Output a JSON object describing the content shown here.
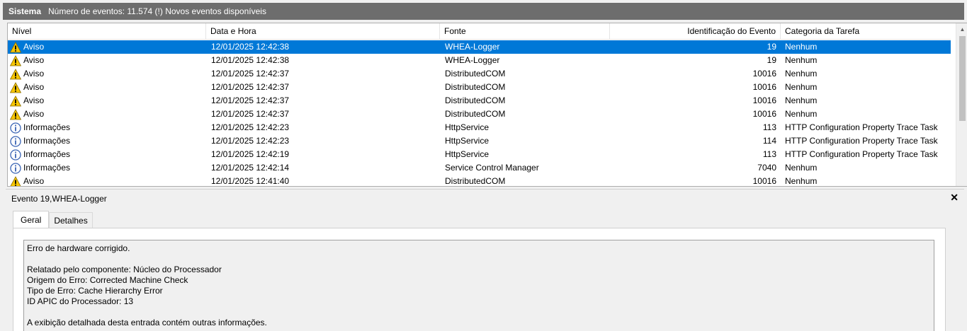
{
  "titlebar": {
    "log_name": "Sistema",
    "event_count": "Número de eventos: 11.574 (!) Novos eventos disponíveis"
  },
  "table": {
    "columns": [
      "Nível",
      "Data e Hora",
      "Fonte",
      "Identificação do Evento",
      "Categoria da Tarefa"
    ],
    "rows": [
      {
        "level": "Aviso",
        "icon": "warning-icon",
        "date": "12/01/2025 12:42:38",
        "source": "WHEA-Logger",
        "id": "19",
        "category": "Nenhum",
        "selected": true
      },
      {
        "level": "Aviso",
        "icon": "warning-icon",
        "date": "12/01/2025 12:42:38",
        "source": "WHEA-Logger",
        "id": "19",
        "category": "Nenhum"
      },
      {
        "level": "Aviso",
        "icon": "warning-icon",
        "date": "12/01/2025 12:42:37",
        "source": "DistributedCOM",
        "id": "10016",
        "category": "Nenhum"
      },
      {
        "level": "Aviso",
        "icon": "warning-icon",
        "date": "12/01/2025 12:42:37",
        "source": "DistributedCOM",
        "id": "10016",
        "category": "Nenhum"
      },
      {
        "level": "Aviso",
        "icon": "warning-icon",
        "date": "12/01/2025 12:42:37",
        "source": "DistributedCOM",
        "id": "10016",
        "category": "Nenhum"
      },
      {
        "level": "Aviso",
        "icon": "warning-icon",
        "date": "12/01/2025 12:42:37",
        "source": "DistributedCOM",
        "id": "10016",
        "category": "Nenhum"
      },
      {
        "level": "Informações",
        "icon": "info-icon",
        "date": "12/01/2025 12:42:23",
        "source": "HttpService",
        "id": "113",
        "category": "HTTP Configuration Property Trace Task"
      },
      {
        "level": "Informações",
        "icon": "info-icon",
        "date": "12/01/2025 12:42:23",
        "source": "HttpService",
        "id": "114",
        "category": "HTTP Configuration Property Trace Task"
      },
      {
        "level": "Informações",
        "icon": "info-icon",
        "date": "12/01/2025 12:42:19",
        "source": "HttpService",
        "id": "113",
        "category": "HTTP Configuration Property Trace Task"
      },
      {
        "level": "Informações",
        "icon": "info-icon",
        "date": "12/01/2025 12:42:14",
        "source": "Service Control Manager",
        "id": "7040",
        "category": "Nenhum"
      },
      {
        "level": "Aviso",
        "icon": "warning-icon",
        "date": "12/01/2025 12:41:40",
        "source": "DistributedCOM",
        "id": "10016",
        "category": "Nenhum"
      }
    ]
  },
  "detail": {
    "title": "Evento 19,WHEA-Logger",
    "close_icon": "close-icon",
    "tabs": [
      "Geral",
      "Detalhes"
    ],
    "message_lines": [
      "Erro de hardware corrigido.",
      "",
      "Relatado pelo componente: Núcleo do Processador",
      "Origem do Erro: Corrected Machine Check",
      "Tipo de Erro: Cache Hierarchy Error",
      "ID APIC do Processador: 13",
      "",
      "A exibição detalhada desta entrada contém outras informações."
    ]
  },
  "colors": {
    "selection": "#0078d7",
    "titlebar": "#6d6d6d",
    "warning": "#f7c600",
    "info": "#3a64b4"
  }
}
